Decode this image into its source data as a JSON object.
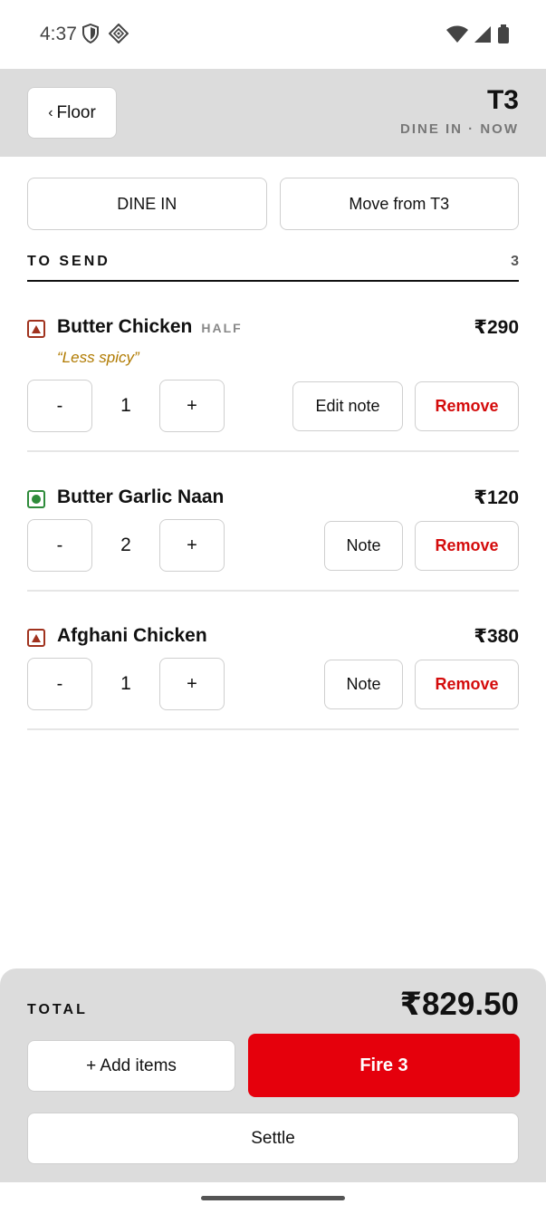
{
  "status": {
    "time": "4:37",
    "icons": [
      "shield-icon",
      "location-diamond-icon",
      "wifi-icon",
      "signal-icon",
      "battery-icon"
    ]
  },
  "header": {
    "back_label": "Floor",
    "table_code": "T3",
    "subtitle": "DINE IN · NOW"
  },
  "mode": {
    "dine_in_label": "DINE IN",
    "move_label": "Move from T3"
  },
  "section": {
    "title": "TO SEND",
    "count": "3"
  },
  "items": [
    {
      "name": "Butter Chicken",
      "variant": "HALF",
      "price": "₹290",
      "note": "“Less spicy”",
      "qty": "1",
      "diet": "non-veg",
      "note_button": "Edit note",
      "remove_label": "Remove",
      "minus": "-",
      "plus": "+"
    },
    {
      "name": "Butter Garlic Naan",
      "variant": "",
      "price": "₹120",
      "note": "",
      "qty": "2",
      "diet": "veg",
      "note_button": "Note",
      "remove_label": "Remove",
      "minus": "-",
      "plus": "+"
    },
    {
      "name": "Afghani Chicken",
      "variant": "",
      "price": "₹380",
      "note": "",
      "qty": "1",
      "diet": "non-veg",
      "note_button": "Note",
      "remove_label": "Remove",
      "minus": "-",
      "plus": "+"
    }
  ],
  "footer": {
    "total_label": "TOTAL",
    "total_value": "₹829.50",
    "add_label": "+ Add items",
    "fire_label": "Fire 3",
    "settle_label": "Settle"
  },
  "colors": {
    "accent_red": "#e5000c",
    "remove_red": "#d40c0c",
    "note_amber": "#b07a00",
    "veg_green": "#2e8b3a",
    "nonveg_brown": "#a0321e",
    "header_gray": "#dcdcdc"
  }
}
